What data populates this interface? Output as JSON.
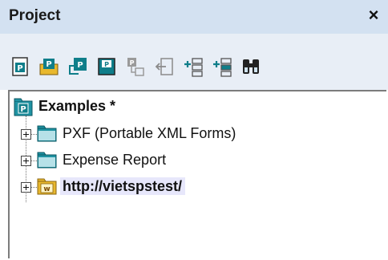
{
  "window": {
    "title": "Project",
    "close_glyph": "×"
  },
  "toolbar": {
    "buttons": [
      {
        "icon": "new-project-icon"
      },
      {
        "icon": "open-project-icon"
      },
      {
        "icon": "reload-project-icon"
      },
      {
        "icon": "save-project-icon"
      },
      {
        "icon": "add-files-icon"
      },
      {
        "icon": "add-external-icon"
      },
      {
        "icon": "add-folder-icon"
      },
      {
        "icon": "add-external-folder-icon"
      },
      {
        "icon": "find-icon"
      }
    ]
  },
  "tree": {
    "root": {
      "label": "Examples *",
      "icon": "project-icon"
    },
    "items": [
      {
        "label": "PXF (Portable XML Forms)",
        "icon": "folder-icon"
      },
      {
        "label": "Expense Report",
        "icon": "folder-icon"
      },
      {
        "label": "http://vietspstest/",
        "icon": "web-folder-icon"
      }
    ]
  },
  "colors": {
    "titlebar": "#d3e1f1",
    "toolbar": "#e8eef6",
    "icon_teal": "#0f7e8a",
    "folder_teal": "#1f93a3",
    "web_folder_yellow": "#e8b82e",
    "selection": "#e7e7fb"
  }
}
